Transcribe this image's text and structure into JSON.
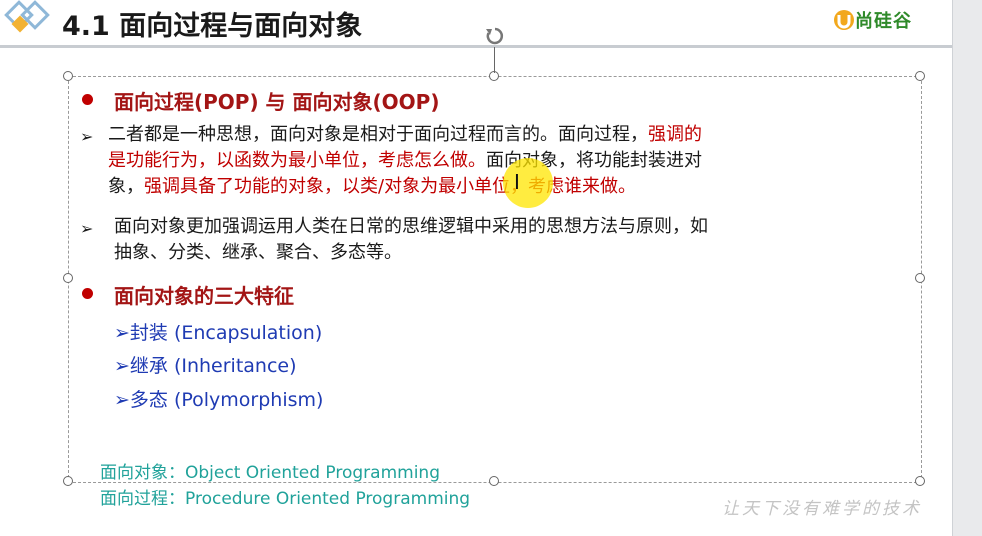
{
  "slide": {
    "title": "4.1 面向过程与面向对象",
    "logo_text": "尚硅谷",
    "heading1": "面向过程(POP) 与 面向对象(OOP)",
    "para1": {
      "line1_a": "二者都是一种思想，面向对象是相对于面向过程而言的。面向过程，",
      "line1_b": "强调的",
      "line2_a": "是功能行为，以函数为最小单位，考虑怎么做。",
      "line2_b": "面向对象，将功能封装进对",
      "line3_a": "象，",
      "line3_b": "强调具备了功能的对象，以类/对象为最小单位，考虑谁来做。"
    },
    "para2": {
      "line1": "面向对象更加强调运用人类在日常的思维逻辑中采用的思想方法与原则，如",
      "line2": "抽象、分类、继承、聚合、多态等。"
    },
    "heading2": "面向对象的三大特征",
    "features": [
      "➢封装 (Encapsulation)",
      "➢继承 (Inheritance)",
      "➢多态 (Polymorphism)"
    ],
    "notes": [
      "面向对象：Object Oriented Programming",
      "面向过程：Procedure Oriented Programming"
    ],
    "watermark": "让天下没有难学的技术"
  },
  "colors": {
    "heading": "#a31515",
    "emphasis": "#c00000",
    "feature": "#1f3bb3",
    "note": "#20a29a",
    "logo": "#2f8a2a"
  },
  "icons": [
    "diamond-logo-icon",
    "rotate-handle-icon",
    "text-cursor-icon",
    "bullet-arrow-icon",
    "bullet-dot-icon"
  ]
}
